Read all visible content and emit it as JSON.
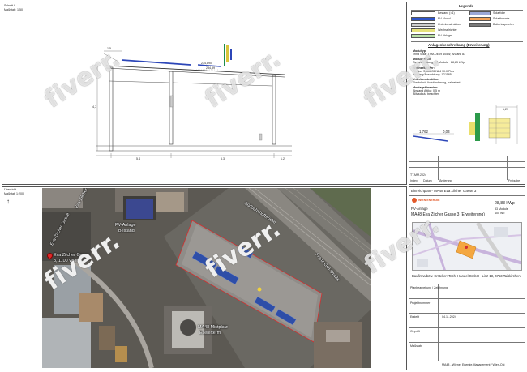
{
  "sheet": {
    "section_title": "Schnitt A",
    "section_scale": "Maßstab: 1:50",
    "overview_title": "Übersicht",
    "overview_scale": "Maßstab 1:200"
  },
  "section_dims": {
    "top_left": "1,5",
    "top_mid": "234,890",
    "top_right": "234,89",
    "height_left": "4,7",
    "span_left": "5,4",
    "span_mid": "6,3",
    "span_right": "1,2"
  },
  "legend": {
    "title": "Legende",
    "rows": [
      {
        "left": "Bestand (=1)",
        "right": "Solarfolie"
      },
      {
        "left": "PV-Modul",
        "right": "Solarthermie"
      },
      {
        "left": "Unterkonstruktion",
        "right": "Batteriespeicher"
      },
      {
        "left": "Wechselrichter",
        "right": ""
      },
      {
        "left": "PV-Ablage",
        "right": ""
      }
    ],
    "description_title": "Anlagenbeschreibung (Erweiterung)",
    "description_lines": [
      "Modultyp:",
      "Trina Solar TSM-DE09 405W, Anzahl: 83",
      "Modulanzahl:",
      "Gesamtleistung: 83 Module · 28,83 kWp",
      "Wechselrichter:",
      "Fronius Symo GEN24 10.0 Plus",
      "Neigung/Ausrichtung: 10°/185°",
      "Unterkonstruktion:",
      "Flachdach-Aufständerung, ballastiert",
      "Montagehinweise:",
      "Abstand Attika: 0,5 m",
      "Blitzschutz beachten"
    ],
    "detail_dim_a": "1,762",
    "detail_dim_b": "0,03",
    "detail_dim_c": "1,21",
    "revision_code": "TT.MM.2024",
    "footer_cells": [
      "Index",
      "Datum",
      "Änderung",
      "Freigabe"
    ]
  },
  "map_labels": {
    "street_1": "Eva-Zilcher-Gasse",
    "street_2": "Eva-Zilcher",
    "bridge": "Südbahnhofbrücke",
    "street_3": "Franz-Grill-Straße",
    "pv_existing_1": "PV-Anlage",
    "pv_existing_2": "Bestand",
    "address_1": "Eva Zilcher Gasse",
    "address_2": "3, 1100 Wien",
    "building_1": "MA48 Mistplatz",
    "building_2": "Eselerterm"
  },
  "title_block": {
    "header": "Einreichplan - MA48 Eva Zilcher Gasse 3",
    "company": "WIEN ENERGIE",
    "project_line_1": "PV-Anlage",
    "project_line_2": "MA48 Eva Zilcher Gasse 3 (Erweiterung)",
    "power": "28,83 kWp",
    "modules": "83 Module",
    "module_power": "405 Wp",
    "installer": "Baufirma bzw. Ersteller: Tech. Handel GmbH · Linz 13, 4753 Taiskirchen",
    "plan_info": [
      "Planbearbeitung / Zeichnung",
      "Projektnummer",
      "Erstellt",
      "Geprüft",
      "Maßstab"
    ],
    "date": "04.11.2024",
    "footer": "MA48 - Wiener Energie-Management / Wien-Ost"
  },
  "watermark": "fiverr."
}
